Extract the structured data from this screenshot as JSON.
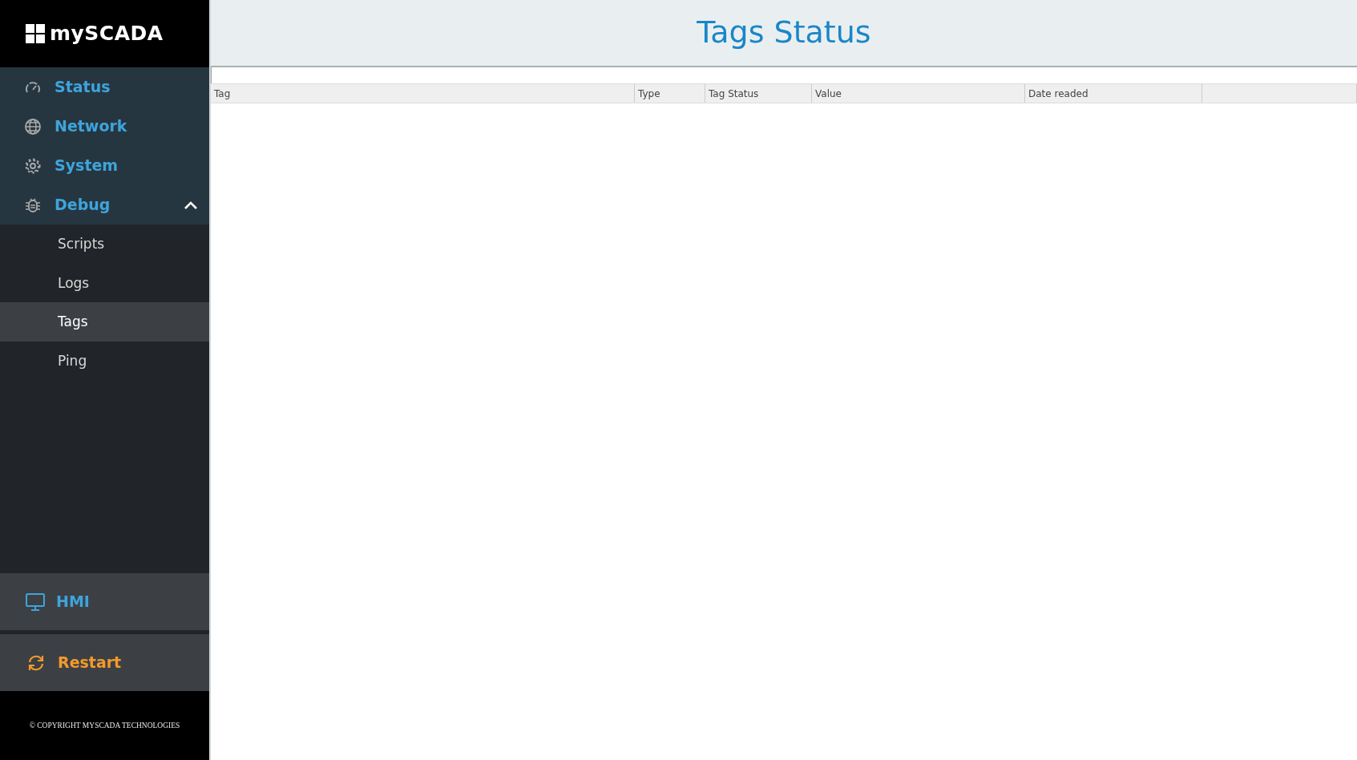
{
  "logo": {
    "text": "mySCADA"
  },
  "sidebar": {
    "items": [
      {
        "label": "Status"
      },
      {
        "label": "Network"
      },
      {
        "label": "System"
      },
      {
        "label": "Debug",
        "expanded": true,
        "children": [
          {
            "label": "Scripts",
            "selected": false
          },
          {
            "label": "Logs",
            "selected": false
          },
          {
            "label": "Tags",
            "selected": true
          },
          {
            "label": "Ping",
            "selected": false
          }
        ]
      }
    ],
    "hmi": {
      "label": "HMI"
    },
    "restart": {
      "label": "Restart"
    },
    "copyright": "© COPYRIGHT MYSCADA TECHNOLOGIES"
  },
  "page": {
    "title": "Tags Status"
  },
  "table": {
    "columns": [
      "Tag",
      "Type",
      "Tag Status",
      "Value",
      "Date readed"
    ]
  }
}
